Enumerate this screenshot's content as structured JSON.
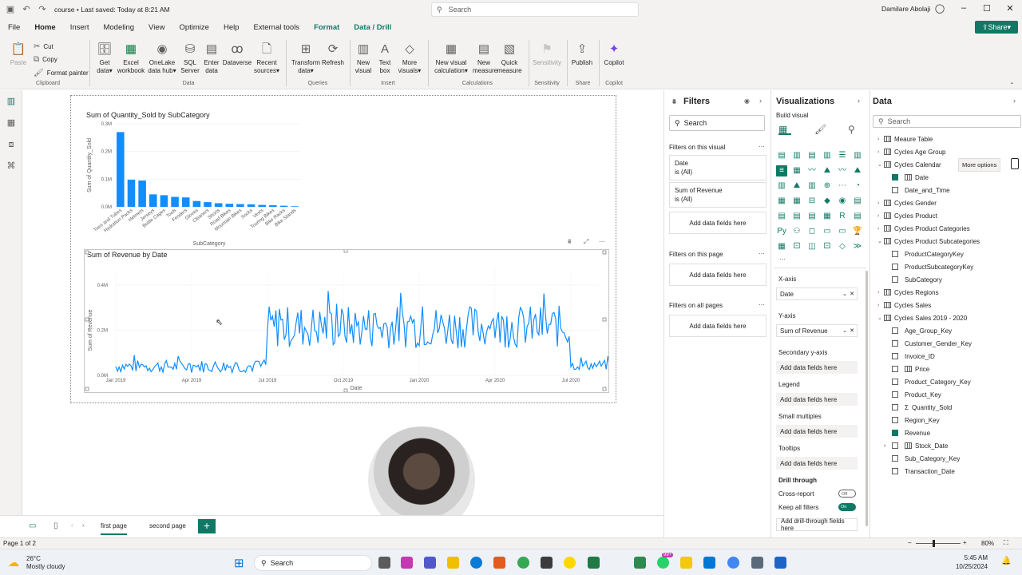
{
  "titlebar": {
    "doc_title": "course • Last saved: Today at 8:21 AM",
    "search_placeholder": "Search",
    "user_name": "Damilare Abolaji"
  },
  "menu": [
    "File",
    "Home",
    "Insert",
    "Modeling",
    "View",
    "Optimize",
    "Help",
    "External tools",
    "Format",
    "Data / Drill"
  ],
  "share_label": "Share",
  "ribbon": {
    "clipboard": {
      "paste": "Paste",
      "cut": "Cut",
      "copy": "Copy",
      "format_painter": "Format painter",
      "label": "Clipboard"
    },
    "data": {
      "get_data": [
        "Get",
        "data"
      ],
      "excel": [
        "Excel",
        "workbook"
      ],
      "onelake": [
        "OneLake",
        "data hub"
      ],
      "sql": [
        "SQL",
        "Server"
      ],
      "enter": [
        "Enter",
        "data"
      ],
      "dataverse": [
        "Dataverse",
        ""
      ],
      "recent": [
        "Recent",
        "sources"
      ],
      "label": "Data"
    },
    "queries": {
      "transform": [
        "Transform",
        "data"
      ],
      "refresh": [
        "Refresh",
        ""
      ],
      "label": "Queries"
    },
    "insert": {
      "new_visual": [
        "New",
        "visual"
      ],
      "text_box": [
        "Text",
        "box"
      ],
      "more_visuals": [
        "More",
        "visuals"
      ],
      "label": "Insert"
    },
    "calculations": {
      "new_visual_calc": [
        "New visual",
        "calculation"
      ],
      "new_measure": [
        "New",
        "measure"
      ],
      "quick_measure": [
        "Quick",
        "measure"
      ],
      "label": "Calculations"
    },
    "sensitivity": {
      "sensitivity": [
        "Sensitivity",
        ""
      ],
      "label": "Sensitivity"
    },
    "share": {
      "publish": [
        "Publish",
        ""
      ],
      "label": "Share"
    },
    "copilot": {
      "copilot": [
        "Copilot",
        ""
      ],
      "label": "Copilot"
    }
  },
  "chart_data": [
    {
      "type": "bar",
      "title": "Sum of Quantity_Sold by SubCategory",
      "xlabel": "SubCategory",
      "ylabel": "Sum of Quantity_Sold",
      "y_ticks": [
        "0.3M",
        "0.2M",
        "0.1M",
        "0.0M"
      ],
      "ylim": [
        0,
        300000
      ],
      "categories": [
        "Tires and Tubes",
        "Hydration Packs",
        "Helmets",
        "Jerseys",
        "Bottle Cages",
        "Tools",
        "Fenders",
        "Gloves",
        "Cleaners",
        "Shorts",
        "Road Bikes",
        "Mountain Bikes",
        "Socks",
        "Vests",
        "Touring Bikes",
        "Bike Racks",
        "Bike Stands"
      ],
      "values": [
        270000,
        98000,
        95000,
        45000,
        42000,
        36000,
        34000,
        21000,
        17000,
        13000,
        11000,
        10000,
        9000,
        7000,
        6000,
        4000,
        2000
      ]
    },
    {
      "type": "line",
      "title": "Sum of Revenue by Date",
      "xlabel": "Date",
      "ylabel": "Sum of Revenue",
      "y_ticks": [
        "0.4M",
        "0.2M",
        "0.0M"
      ],
      "ylim": [
        0,
        400000
      ],
      "x_ticks": [
        "Jan 2019",
        "Apr 2019",
        "Jul 2019",
        "Oct 2019",
        "Jan 2020",
        "Apr 2020",
        "Jul 2020"
      ],
      "segments": [
        {
          "from": "Jan 2019",
          "to": "Jun 2019",
          "base": 40000,
          "amp": 28000
        },
        {
          "from": "Jul 2019",
          "to": "Jun 2020",
          "base": 215000,
          "amp": 95000
        },
        {
          "from": "Jul 2020",
          "to": "Aug 2020",
          "base": 45000,
          "amp": 22000
        }
      ]
    }
  ],
  "filters": {
    "title": "Filters",
    "search_placeholder": "Search",
    "on_visual": "Filters on this visual",
    "cards": [
      {
        "name": "Date",
        "state": "is (All)"
      },
      {
        "name": "Sum of Revenue",
        "state": "is (All)"
      }
    ],
    "add": "Add data fields here",
    "on_page": "Filters on this page",
    "on_all": "Filters on all pages"
  },
  "viz": {
    "title": "Visualizations",
    "build": "Build visual",
    "x_axis": "X-axis",
    "x_field": "Date",
    "y_axis": "Y-axis",
    "y_field": "Sum of Revenue",
    "secondary": "Secondary y-axis",
    "legend": "Legend",
    "small_multiples": "Small multiples",
    "tooltips": "Tooltips",
    "add": "Add data fields here",
    "drill": "Drill through",
    "cross_report": "Cross-report",
    "cross_state": "Off",
    "keep_filters": "Keep all filters",
    "keep_state": "On",
    "add_drill": "Add drill-through fields here"
  },
  "data": {
    "title": "Data",
    "search_placeholder": "Search",
    "more_options": "More options",
    "rows": [
      {
        "label": "Meaure Table",
        "level": 0,
        "kind": "table"
      },
      {
        "label": "Cycles Age Group",
        "level": 0,
        "kind": "table"
      },
      {
        "label": "Cycles Calendar",
        "level": 0,
        "kind": "table-open"
      },
      {
        "label": "Date",
        "level": 1,
        "kind": "hier-checked"
      },
      {
        "label": "Date_and_Time",
        "level": 1,
        "kind": "field"
      },
      {
        "label": "Cycles Gender",
        "level": 0,
        "kind": "table"
      },
      {
        "label": "Cycles Product",
        "level": 0,
        "kind": "table"
      },
      {
        "label": "Cycles Product Categories",
        "level": 0,
        "kind": "table"
      },
      {
        "label": "Cycles Product Subcategories",
        "level": 0,
        "kind": "table-open"
      },
      {
        "label": "ProductCategoryKey",
        "level": 1,
        "kind": "field"
      },
      {
        "label": "ProductSubcategoryKey",
        "level": 1,
        "kind": "field"
      },
      {
        "label": "SubCategory",
        "level": 1,
        "kind": "field"
      },
      {
        "label": "Cycles Regions",
        "level": 0,
        "kind": "table"
      },
      {
        "label": "Cycles Sales",
        "level": 0,
        "kind": "table"
      },
      {
        "label": "Cycles Sales 2019 - 2020",
        "level": 0,
        "kind": "table-open"
      },
      {
        "label": "Age_Group_Key",
        "level": 1,
        "kind": "field"
      },
      {
        "label": "Customer_Gender_Key",
        "level": 1,
        "kind": "field"
      },
      {
        "label": "Invoice_ID",
        "level": 1,
        "kind": "field"
      },
      {
        "label": "Price",
        "level": 1,
        "kind": "field-table"
      },
      {
        "label": "Product_Category_Key",
        "level": 1,
        "kind": "field"
      },
      {
        "label": "Product_Key",
        "level": 1,
        "kind": "field"
      },
      {
        "label": "Quantity_Sold",
        "level": 1,
        "kind": "field-sigma"
      },
      {
        "label": "Region_Key",
        "level": 1,
        "kind": "field"
      },
      {
        "label": "Revenue",
        "level": 1,
        "kind": "field-checked"
      },
      {
        "label": "Stock_Date",
        "level": 1,
        "kind": "hier"
      },
      {
        "label": "Sub_Category_Key",
        "level": 1,
        "kind": "field"
      },
      {
        "label": "Transaction_Date",
        "level": 1,
        "kind": "field"
      }
    ]
  },
  "pages": {
    "first": "first page",
    "second": "second page",
    "add": "+"
  },
  "status": {
    "page": "Page 1 of 2",
    "zoom": "80%"
  },
  "taskbar": {
    "weather_temp": "26°C",
    "weather_desc": "Mostly cloudy",
    "search": "Search",
    "time": "5:45 AM",
    "date": "10/25/2024",
    "badge": "99+"
  },
  "colors": {
    "accent": "#117865",
    "series": "#118dff"
  }
}
